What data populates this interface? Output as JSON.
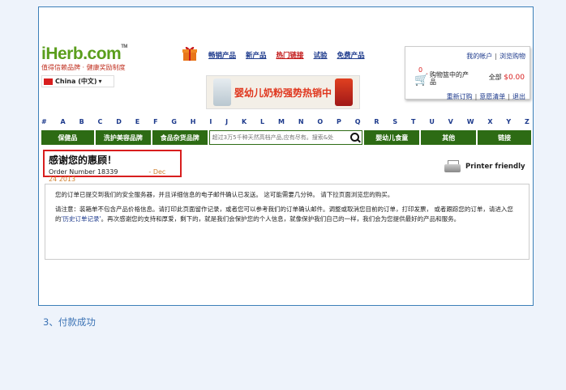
{
  "logo": {
    "name": "iHerb",
    "suffix": ".com",
    "tm": "TM",
    "tagline": "值得信赖品牌 · 健康奖励制度"
  },
  "locale": {
    "label": "China (中文)",
    "caret": "▾"
  },
  "topnav": [
    "畅销产品",
    "新产品",
    "热门链接",
    "试验",
    "免费产品"
  ],
  "promo": {
    "text": "婴幼儿奶粉强势热销中"
  },
  "account": {
    "my_account": "我的帐户",
    "recent_viewed": "浏览购物",
    "cart_count": "0",
    "cart_label": "购物篮中的产品",
    "total_label": "全部",
    "total_value": "$0.00",
    "reorder": "重新订购",
    "wishlist": "意愿清单",
    "logout": "退出"
  },
  "alphabet": [
    "#",
    "A",
    "B",
    "C",
    "D",
    "E",
    "F",
    "G",
    "H",
    "I",
    "J",
    "K",
    "L",
    "M",
    "N",
    "O",
    "P",
    "Q",
    "R",
    "S",
    "T",
    "U",
    "V",
    "W",
    "X",
    "Y",
    "Z"
  ],
  "categories": [
    "保健品",
    "洗护美容品牌",
    "食品杂货品牌",
    "婴幼儿食童",
    "其他",
    "链接"
  ],
  "search": {
    "placeholder": "超过3万5千种天然高档产品,应有尽有。搜索&处"
  },
  "thanks": {
    "title": "感谢您的惠顾！",
    "order_label": "Order Number 18339",
    "date": "- Dec 24 2013"
  },
  "printer": {
    "label": "Printer friendly"
  },
  "message": {
    "line1": "您的订单已提交到我们的安全服务器，并且详细信息的电子邮件确认已发送。 这可能需要几分钟。 请下拉页面浏览您的购买。",
    "note_pre": "请注意：装箱单不包含产品价格信息。请打印此页面留作记录，或者您可以参考我们的订单确认邮件。调整或取消您目前的订单，打印发票， 或者跟踪您的订单，请进入您的",
    "note_link": "'历史订单记录'",
    "note_post": "。再次感谢您的支持和厚爱，剩下的，就是我们会保护您的个人信息，就像保护我们自己的一样，我们会为您提供最好的产品和服务。"
  },
  "caption": "3、付款成功"
}
